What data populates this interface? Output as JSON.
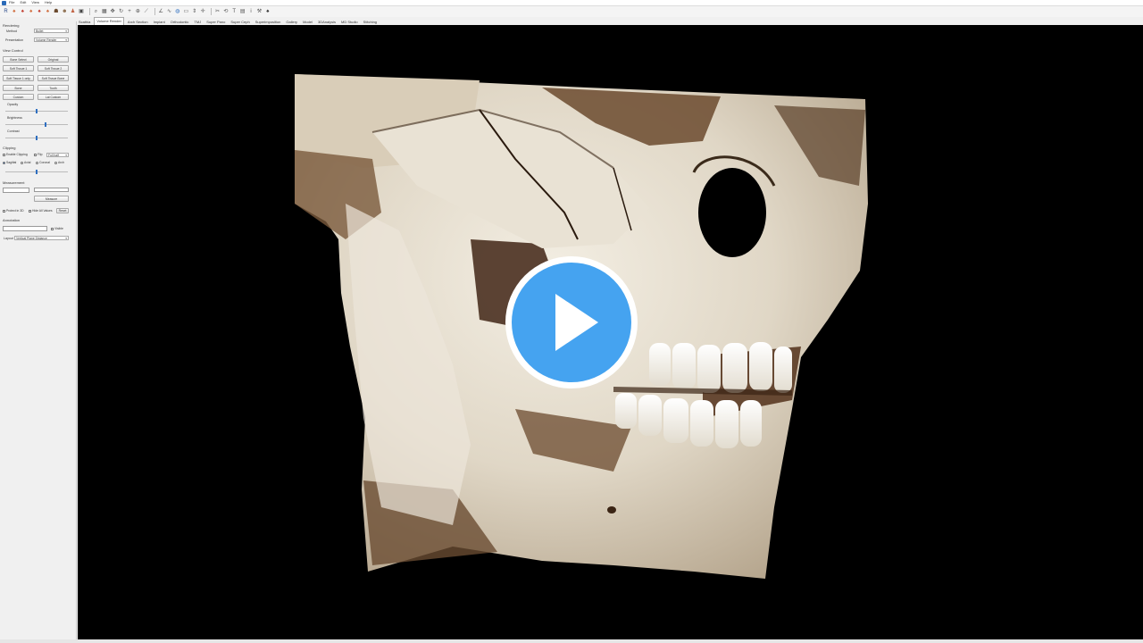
{
  "menu": {
    "items": [
      "File",
      "Edit",
      "View",
      "Help"
    ]
  },
  "toolbar": {
    "icons": [
      "r-logo-icon",
      "tooth-icon",
      "tooth-red-icon",
      "tooth-icon",
      "tooth-red-icon",
      "tooth-icon",
      "skull-icon",
      "face-icon",
      "torso-icon",
      "camera-icon",
      "search-icon",
      "image-icon",
      "move-icon",
      "rotate-icon",
      "plus-icon",
      "zoom-icon",
      "measure-icon",
      "angle-icon",
      "curve-icon",
      "globe-icon",
      "ruler-icon",
      "arrows-icon",
      "crosshair-icon",
      "cut-icon",
      "reset-icon",
      "text-icon",
      "grid-icon",
      "info-icon",
      "wrench-icon",
      "tooth-dark-icon"
    ]
  },
  "tabs": [
    {
      "label": "Scathia",
      "active": false
    },
    {
      "label": "Volume Render",
      "active": true
    },
    {
      "label": "Arch Section",
      "active": false
    },
    {
      "label": "Implant",
      "active": false
    },
    {
      "label": "Orthodontic",
      "active": false
    },
    {
      "label": "TMJ",
      "active": false
    },
    {
      "label": "Super Pano",
      "active": false
    },
    {
      "label": "Super Ceph",
      "active": false
    },
    {
      "label": "Superimposition",
      "active": false
    },
    {
      "label": "Gallery",
      "active": false
    },
    {
      "label": "Model",
      "active": false
    },
    {
      "label": "3DAnalysis",
      "active": false
    },
    {
      "label": "MD Studio",
      "active": false
    },
    {
      "label": "Stitching",
      "active": false
    }
  ],
  "sidebar": {
    "rendering": {
      "title": "Rendering",
      "method_label": "Method",
      "method_value": "Bullet",
      "preset_label": "Presentation",
      "preset_value": "Volume Render"
    },
    "view_control": {
      "title": "View Control",
      "buttons": [
        "Bone Select",
        "Original",
        "Soft Tissue 1",
        "Soft Tissue 2",
        "Soft Tissue 1 only",
        "Soft Tissue Bone",
        "Bone",
        "Tooth",
        "Custom",
        "Lat Custom"
      ],
      "opacity_label": "Opacity",
      "opacity_value": 0.5,
      "brightness_label": "Brightness",
      "brightness_value": 0.65,
      "contrast_label": "Contrast",
      "contrast_value": 0.5
    },
    "clipping": {
      "title": "Clipping",
      "enable_label": "Enable Clipping",
      "flip_label": "Flip",
      "mode_value": "Full half",
      "radios": [
        "Sagittal",
        "Axial",
        "Coronal",
        "Arch"
      ],
      "slider_value": 0.5
    },
    "measurement": {
      "title": "Measurement",
      "button_label": "Measure"
    },
    "options": {
      "protect_label": "Protect in 3D",
      "hide_label": "Hide All Values",
      "reset_label": "Reset"
    },
    "annotation": {
      "title": "Annotation",
      "visible_label": "Visible",
      "layout_label": "Layout",
      "layout_value": "Vertical Plane Distance"
    }
  }
}
